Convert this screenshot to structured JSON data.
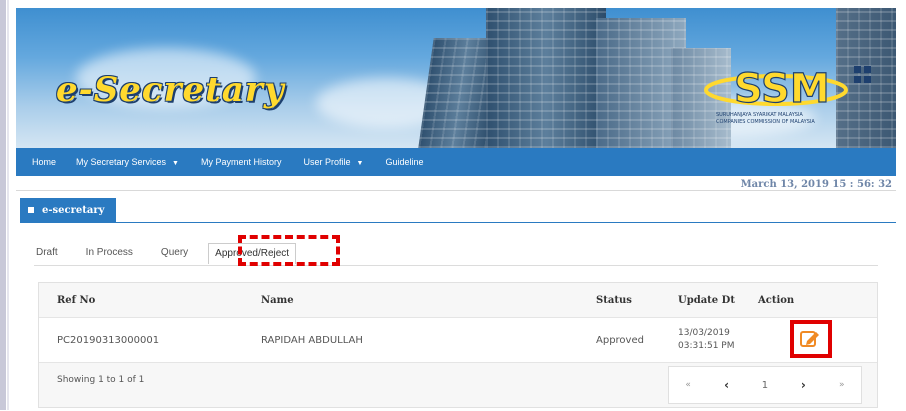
{
  "header": {
    "logo_text": "e-Secretary",
    "ssm_logo": "SSM",
    "ssm_subtext_1": "SURUHANJAYA SYARIKAT MALAYSIA",
    "ssm_subtext_2": "COMPANIES COMMISSION OF MALAYSIA"
  },
  "nav": {
    "items": [
      {
        "label": "Home"
      },
      {
        "label": "My Secretary Services",
        "caret": "▼"
      },
      {
        "label": "My Payment History"
      },
      {
        "label": "User Profile",
        "caret": "▼"
      },
      {
        "label": "Guideline"
      }
    ]
  },
  "datetime": "March 13, 2019 15 : 56: 32",
  "panel": {
    "title": "e-secretary"
  },
  "tabs": [
    "Draft",
    "In Process",
    "Query",
    "Approved/Reject"
  ],
  "active_tab": "Approved/Reject",
  "table": {
    "columns": [
      "Ref No",
      "Name",
      "Status",
      "Update Dt",
      "Action"
    ],
    "rows": [
      {
        "ref_no": "PC20190313000001",
        "name": "RAPIDAH ABDULLAH",
        "status": "Approved",
        "update_date": "13/03/2019",
        "update_time": "03:31:51 PM",
        "action_icon": "edit-icon"
      }
    ],
    "showing": "Showing 1 to 1 of 1"
  },
  "pager": {
    "first": "«",
    "prev": "‹",
    "page": "1",
    "next": "›",
    "last": "»"
  },
  "colors": {
    "nav": "#2a7ac1",
    "highlight": "#e00000",
    "logo": "#ffd92e",
    "action_icon": "#f08a24"
  }
}
